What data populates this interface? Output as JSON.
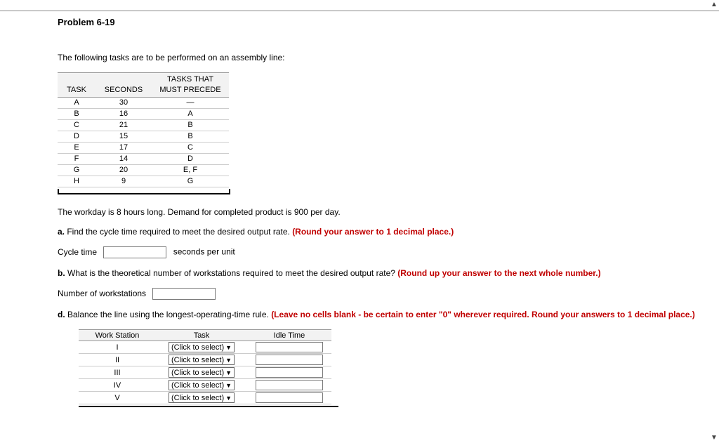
{
  "title": "Problem 6-19",
  "intro": "The following tasks are to be performed on an assembly line:",
  "task_table": {
    "headers": {
      "task": "TASK",
      "seconds": "SECONDS",
      "precede": "TASKS THAT MUST PRECEDE"
    },
    "rows": [
      {
        "task": "A",
        "seconds": "30",
        "precede": "—"
      },
      {
        "task": "B",
        "seconds": "16",
        "precede": "A"
      },
      {
        "task": "C",
        "seconds": "21",
        "precede": "B"
      },
      {
        "task": "D",
        "seconds": "15",
        "precede": "B"
      },
      {
        "task": "E",
        "seconds": "17",
        "precede": "C"
      },
      {
        "task": "F",
        "seconds": "14",
        "precede": "D"
      },
      {
        "task": "G",
        "seconds": "20",
        "precede": "E, F"
      },
      {
        "task": "H",
        "seconds": "9",
        "precede": "G"
      }
    ]
  },
  "workday_line": "The workday is 8 hours long. Demand for completed product is 900 per day.",
  "part_a": {
    "letter": "a.",
    "text": " Find the cycle time required to meet the desired output rate. ",
    "hint": "(Round your answer to 1 decimal place.)",
    "label": "Cycle time",
    "unit": "seconds per unit"
  },
  "part_b": {
    "letter": "b.",
    "text": " What is the theoretical number of workstations required to meet the desired output rate? ",
    "hint": "(Round up your answer to the next whole number.)",
    "label": "Number of workstations"
  },
  "part_d": {
    "letter": "d.",
    "text": " Balance the line using the longest-operating-time rule. ",
    "hint": "(Leave no cells blank - be certain to enter \"0\" wherever required. Round your answers to 1 decimal place.)"
  },
  "ws_table": {
    "headers": {
      "ws": "Work Station",
      "task": "Task",
      "idle": "Idle Time"
    },
    "select_label": "(Click to select)",
    "stations": [
      "I",
      "II",
      "III",
      "IV",
      "V"
    ]
  }
}
